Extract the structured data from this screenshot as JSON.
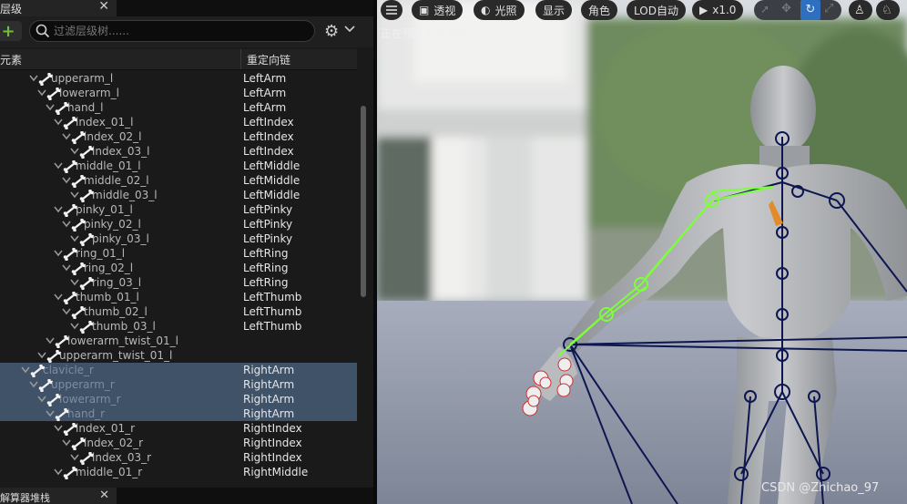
{
  "left_panel": {
    "tab_title": "层级",
    "close_glyph": "✕",
    "add_glyph": "+",
    "search_placeholder": "过滤层级树......",
    "header_col1": "元素",
    "header_col2": "重定向链",
    "bottom_tab_title": "解算器堆栈",
    "rows": [
      {
        "name": "upperarm_l",
        "chain": "LeftArm",
        "depth": 4,
        "selected": false
      },
      {
        "name": "lowerarm_l",
        "chain": "LeftArm",
        "depth": 5,
        "selected": false
      },
      {
        "name": "hand_l",
        "chain": "LeftArm",
        "depth": 6,
        "selected": false
      },
      {
        "name": "index_01_l",
        "chain": "LeftIndex",
        "depth": 7,
        "selected": false
      },
      {
        "name": "index_02_l",
        "chain": "LeftIndex",
        "depth": 8,
        "selected": false
      },
      {
        "name": "index_03_l",
        "chain": "LeftIndex",
        "depth": 9,
        "selected": false
      },
      {
        "name": "middle_01_l",
        "chain": "LeftMiddle",
        "depth": 7,
        "selected": false
      },
      {
        "name": "middle_02_l",
        "chain": "LeftMiddle",
        "depth": 8,
        "selected": false
      },
      {
        "name": "middle_03_l",
        "chain": "LeftMiddle",
        "depth": 9,
        "selected": false
      },
      {
        "name": "pinky_01_l",
        "chain": "LeftPinky",
        "depth": 7,
        "selected": false
      },
      {
        "name": "pinky_02_l",
        "chain": "LeftPinky",
        "depth": 8,
        "selected": false
      },
      {
        "name": "pinky_03_l",
        "chain": "LeftPinky",
        "depth": 9,
        "selected": false
      },
      {
        "name": "ring_01_l",
        "chain": "LeftRing",
        "depth": 7,
        "selected": false
      },
      {
        "name": "ring_02_l",
        "chain": "LeftRing",
        "depth": 8,
        "selected": false
      },
      {
        "name": "ring_03_l",
        "chain": "LeftRing",
        "depth": 9,
        "selected": false
      },
      {
        "name": "thumb_01_l",
        "chain": "LeftThumb",
        "depth": 7,
        "selected": false
      },
      {
        "name": "thumb_02_l",
        "chain": "LeftThumb",
        "depth": 8,
        "selected": false
      },
      {
        "name": "thumb_03_l",
        "chain": "LeftThumb",
        "depth": 9,
        "selected": false
      },
      {
        "name": "lowerarm_twist_01_l",
        "chain": "",
        "depth": 6,
        "selected": false
      },
      {
        "name": "upperarm_twist_01_l",
        "chain": "",
        "depth": 5,
        "selected": false
      },
      {
        "name": "clavicle_r",
        "chain": "RightArm",
        "depth": 3,
        "selected": true
      },
      {
        "name": "upperarm_r",
        "chain": "RightArm",
        "depth": 4,
        "selected": true
      },
      {
        "name": "lowerarm_r",
        "chain": "RightArm",
        "depth": 5,
        "selected": true
      },
      {
        "name": "hand_r",
        "chain": "RightArm",
        "depth": 6,
        "selected": true
      },
      {
        "name": "index_01_r",
        "chain": "RightIndex",
        "depth": 7,
        "selected": false
      },
      {
        "name": "index_02_r",
        "chain": "RightIndex",
        "depth": 8,
        "selected": false
      },
      {
        "name": "index_03_r",
        "chain": "RightIndex",
        "depth": 9,
        "selected": false
      },
      {
        "name": "middle_01_r",
        "chain": "RightMiddle",
        "depth": 7,
        "selected": false
      }
    ]
  },
  "viewport": {
    "buttons": [
      {
        "id": "perspective",
        "icon": "cube-icon",
        "label": "透视"
      },
      {
        "id": "lit",
        "icon": "light-icon",
        "label": "光照"
      },
      {
        "id": "show",
        "icon": "",
        "label": "显示"
      },
      {
        "id": "character",
        "icon": "",
        "label": "角色"
      },
      {
        "id": "lod",
        "icon": "",
        "label": "LOD自动"
      },
      {
        "id": "playrate",
        "icon": "play-icon",
        "label": "x1.0"
      }
    ],
    "status_text": "正在预览参考姿势",
    "watermark": "CSDN @Zhichao_97"
  },
  "colors": {
    "selection": "#3f5268",
    "bone_lines": "#7cff3a",
    "skeleton": "#0d1650"
  }
}
